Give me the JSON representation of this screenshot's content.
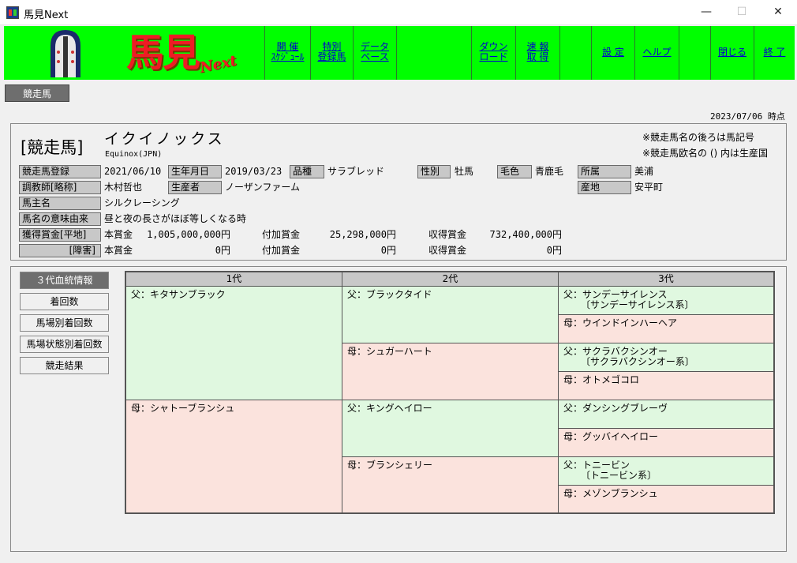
{
  "window": {
    "title": "馬見Next",
    "min_glyph": "—",
    "max_glyph": "☐",
    "close_glyph": "✕"
  },
  "logo": {
    "text": "馬見",
    "next": "Next"
  },
  "menu": [
    {
      "line1": "開 催",
      "line2": "ｽｹｼﾞｭｰﾙ"
    },
    {
      "line1": "特別",
      "line2": "登録馬"
    },
    {
      "line1": "データ",
      "line2": "ベース"
    },
    {
      "line1": "",
      "line2": ""
    },
    {
      "line1": "ダウン",
      "line2": "ロード"
    },
    {
      "line1": "速 報",
      "line2": "取 得"
    },
    {
      "line1": "",
      "line2": ""
    },
    {
      "line1": "設 定",
      "line2": ""
    },
    {
      "line1": "ヘルプ",
      "line2": ""
    },
    {
      "line1": "",
      "line2": ""
    },
    {
      "line1": "閉じる",
      "line2": ""
    },
    {
      "line1": "終 了",
      "line2": ""
    }
  ],
  "section_tab": "競走馬",
  "as_of": "2023/07/06 時点",
  "horse": {
    "big_label": "[競走馬]",
    "name": "イクイノックス",
    "name_en": "Equinox(JPN)",
    "note1": "※競走馬名の後ろは馬記号",
    "note2": "※競走馬欧名の () 内は生産国",
    "labels": {
      "registered": "競走馬登録",
      "birthday": "生年月日",
      "breed": "品種",
      "sex": "性別",
      "coat": "毛色",
      "affiliation": "所属",
      "trainer": "調教師[略称]",
      "breeder": "生産者",
      "origin": "産地",
      "owner": "馬主名",
      "meaning": "馬名の意味由来",
      "prize_flat": "獲得賞金[平地]",
      "prize_jump": "[障害]"
    },
    "values": {
      "registered": "2021/06/10",
      "birthday": "2019/03/23",
      "breed": "サラブレッド",
      "sex": "牡馬",
      "coat": "青鹿毛",
      "affiliation": "美浦",
      "trainer": "木村哲也",
      "breeder": "ノーザンファーム",
      "origin": "安平町",
      "owner": "シルクレーシング",
      "meaning": "昼と夜の長さがほぼ等しくなる時"
    },
    "prize_labels": {
      "main": "本賞金",
      "extra": "付加賞金",
      "earned": "収得賞金"
    },
    "prize_flat": {
      "main": "1,005,000,000円",
      "extra": "25,298,000円",
      "earned": "732,400,000円"
    },
    "prize_jump": {
      "main": "0円",
      "extra": "0円",
      "earned": "0円"
    }
  },
  "side_buttons": [
    "３代血統情報",
    "着回数",
    "馬場別着回数",
    "馬場状態別着回数",
    "競走結果"
  ],
  "pedigree": {
    "headers": [
      "1代",
      "2代",
      "3代"
    ],
    "gen1": [
      "父：キタサンブラック",
      "母：シャトーブランシュ"
    ],
    "gen2": [
      "父：ブラックタイド",
      "母：シュガーハート",
      "父：キングヘイロー",
      "母：ブランシェリー"
    ],
    "gen3": [
      {
        "name": "父：サンデーサイレンス",
        "line": "〔サンデーサイレンス系〕"
      },
      {
        "name": "母：ウインドインハーヘア",
        "line": ""
      },
      {
        "name": "父：サクラバクシンオー",
        "line": "〔サクラバクシンオー系〕"
      },
      {
        "name": "母：オトメゴコロ",
        "line": ""
      },
      {
        "name": "父：ダンシングブレーヴ",
        "line": ""
      },
      {
        "name": "母：グッバイヘイロー",
        "line": ""
      },
      {
        "name": "父：トニービン",
        "line": "〔トニービン系〕"
      },
      {
        "name": "母：メゾンブランシュ",
        "line": ""
      }
    ]
  }
}
